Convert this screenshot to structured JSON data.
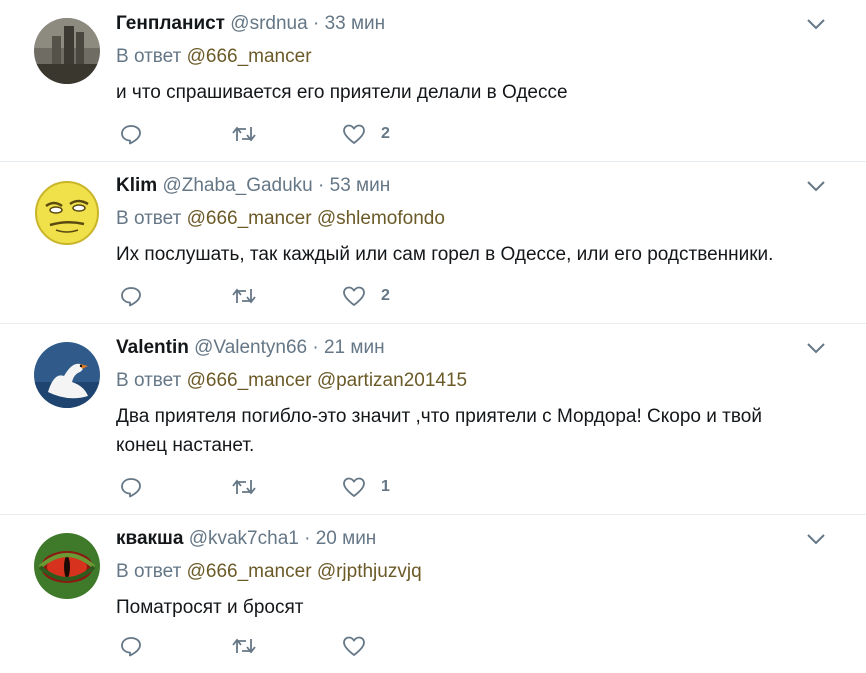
{
  "tweets": [
    {
      "name": "Генпланист",
      "handle": "@srdnua",
      "dot": "·",
      "time": "33 мин",
      "reply_prefix": "В ответ",
      "mentions": [
        "@666_mancer"
      ],
      "text": "и что спрашивается его приятели делали в Одессе",
      "likes": "2"
    },
    {
      "name": "Klim",
      "handle": "@Zhaba_Gaduku",
      "dot": "·",
      "time": "53 мин",
      "reply_prefix": "В ответ",
      "mentions": [
        "@666_mancer",
        "@shlemofondo"
      ],
      "text": "Их послушать, так каждый или сам горел в Одессе, или его родственники.",
      "likes": "2"
    },
    {
      "name": "Valentin",
      "handle": "@Valentyn66",
      "dot": "·",
      "time": "21 мин",
      "reply_prefix": "В ответ",
      "mentions": [
        "@666_mancer",
        "@partizan201415"
      ],
      "text_line1": "Два приятеля погибло-это значит ,что приятели с Мордора! Скоро и твой",
      "text_line2": "конец настанет.",
      "likes": "1"
    },
    {
      "name": "квакша",
      "handle": "@kvak7cha1",
      "dot": "·",
      "time": "20 мин",
      "reply_prefix": "В ответ",
      "mentions": [
        "@666_mancer",
        "@rjpthjuzvjq"
      ],
      "text": "Поматросят и бросят",
      "likes": ""
    }
  ],
  "icons": {
    "reply": "reply-icon",
    "retweet": "retweet-icon",
    "like": "heart-icon",
    "menu": "chevron-down-icon"
  },
  "colors": {
    "secondary_text": "#657786",
    "mention": "#6b5a28",
    "divider": "#e6ecf0"
  }
}
